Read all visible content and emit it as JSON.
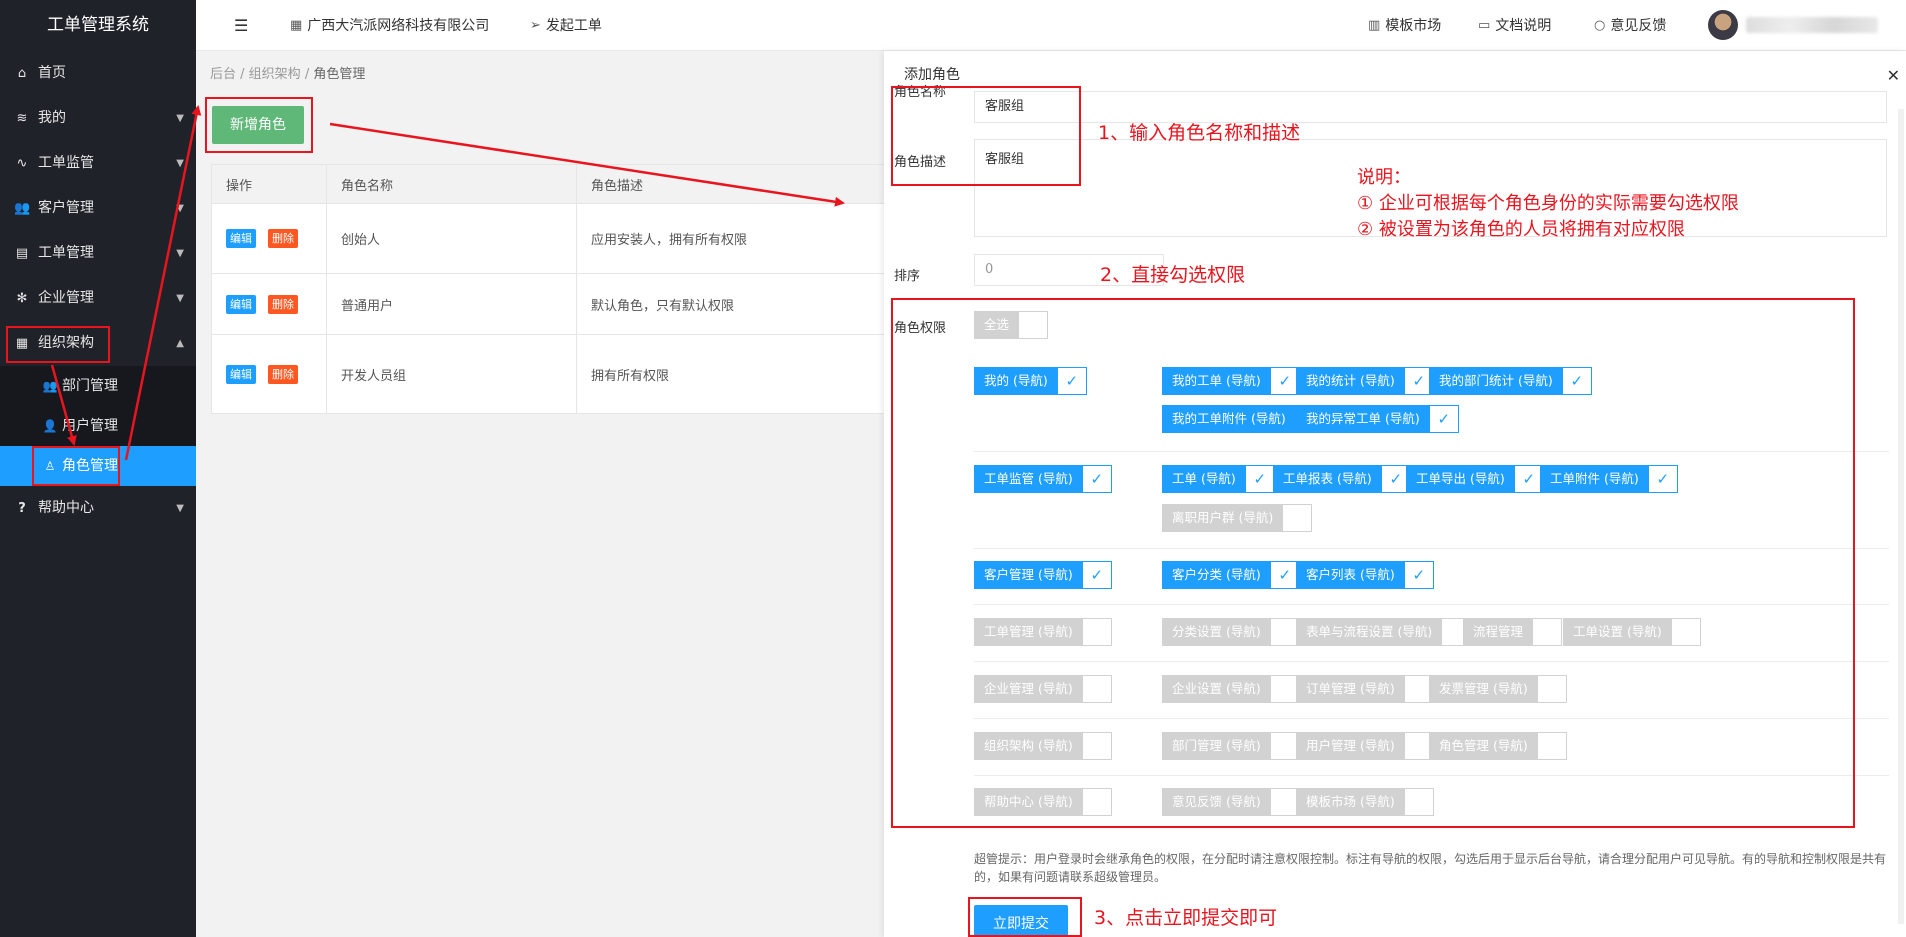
{
  "app": {
    "title": "工单管理系统"
  },
  "sidebar": {
    "items": [
      {
        "label": "首页",
        "icon": "home-icon"
      },
      {
        "label": "我的",
        "icon": "layers-icon"
      },
      {
        "label": "工单监管",
        "icon": "pulse-icon"
      },
      {
        "label": "客户管理",
        "icon": "users-icon"
      },
      {
        "label": "工单管理",
        "icon": "document-icon"
      },
      {
        "label": "企业管理",
        "icon": "gear-icon"
      },
      {
        "label": "组织架构",
        "icon": "org-icon"
      },
      {
        "label": "帮助中心",
        "icon": "question-icon"
      }
    ],
    "sub_items": [
      {
        "label": "部门管理",
        "icon": "users-icon"
      },
      {
        "label": "用户管理",
        "icon": "user-icon"
      },
      {
        "label": "角色管理",
        "icon": "user-outline-icon",
        "active": true
      }
    ]
  },
  "header": {
    "company": "广西大汽派网络科技有限公司",
    "create_ticket": "发起工单",
    "template_market": "模板市场",
    "docs": "文档说明",
    "feedback": "意见反馈"
  },
  "main": {
    "breadcrumb": [
      "后台",
      "组织架构",
      "角色管理"
    ],
    "add_button": "新增角色",
    "table": {
      "headers": [
        "操作",
        "角色名称",
        "角色描述"
      ],
      "edit_label": "编辑",
      "delete_label": "删除",
      "rows": [
        {
          "name": "创始人",
          "desc": "应用安装人，拥有所有权限"
        },
        {
          "name": "普通用户",
          "desc": "默认角色，只有默认权限"
        },
        {
          "name": "开发人员组",
          "desc": "拥有所有权限"
        }
      ]
    }
  },
  "drawer": {
    "title": "添加角色",
    "close": "✕",
    "role_name_label": "角色名称",
    "role_name_value": "客服组",
    "role_desc_label": "角色描述",
    "role_desc_value": "客服组",
    "sort_label": "排序",
    "sort_value": "0",
    "perm_label": "角色权限",
    "select_all": "全选",
    "permissions": [
      {
        "label": "我的 (导航)",
        "checked": true
      },
      {
        "label": "我的工单 (导航)",
        "checked": true
      },
      {
        "label": "我的统计 (导航)",
        "checked": true
      },
      {
        "label": "我的部门统计 (导航)",
        "checked": true
      },
      {
        "label": "我的工单附件 (导航)",
        "checked": true
      },
      {
        "label": "我的异常工单 (导航)",
        "checked": true
      },
      {
        "label": "工单监管 (导航)",
        "checked": true
      },
      {
        "label": "工单 (导航)",
        "checked": true
      },
      {
        "label": "工单报表 (导航)",
        "checked": true
      },
      {
        "label": "工单导出 (导航)",
        "checked": true
      },
      {
        "label": "工单附件 (导航)",
        "checked": true
      },
      {
        "label": "离职用户群 (导航)",
        "checked": false
      },
      {
        "label": "客户管理 (导航)",
        "checked": true
      },
      {
        "label": "客户分类 (导航)",
        "checked": true
      },
      {
        "label": "客户列表 (导航)",
        "checked": true
      },
      {
        "label": "工单管理 (导航)",
        "checked": false
      },
      {
        "label": "分类设置 (导航)",
        "checked": false
      },
      {
        "label": "表单与流程设置 (导航)",
        "checked": false
      },
      {
        "label": "流程管理",
        "checked": false
      },
      {
        "label": "工单设置 (导航)",
        "checked": false
      },
      {
        "label": "企业管理 (导航)",
        "checked": false
      },
      {
        "label": "企业设置 (导航)",
        "checked": false
      },
      {
        "label": "订单管理 (导航)",
        "checked": false
      },
      {
        "label": "发票管理 (导航)",
        "checked": false
      },
      {
        "label": "组织架构 (导航)",
        "checked": false
      },
      {
        "label": "部门管理 (导航)",
        "checked": false
      },
      {
        "label": "用户管理 (导航)",
        "checked": false
      },
      {
        "label": "角色管理 (导航)",
        "checked": false
      },
      {
        "label": "帮助中心 (导航)",
        "checked": false
      },
      {
        "label": "意见反馈 (导航)",
        "checked": false
      },
      {
        "label": "模板市场 (导航)",
        "checked": false
      }
    ],
    "tip": "超管提示：用户登录时会继承角色的权限，在分配时请注意权限控制。标注有导航的权限，勾选后用于显示后台导航，请合理分配用户可见导航。有的导航和控制权限是共有的，如果有问题请联系超级管理员。",
    "submit": "立即提交"
  },
  "annotations": {
    "step1": "1、输入角色名称和描述",
    "step2": "2、直接勾选权限",
    "step3": "3、点击立即提交即可",
    "note_title": "说明：",
    "note_1": "① 企业可根据每个角色身份的实际需要勾选权限",
    "note_2": "② 被设置为该角色的人员将拥有对应权限",
    "color": "#e8151f"
  },
  "colors": {
    "sidebar_bg": "#20222a",
    "active_blue": "#1e9fff",
    "green": "#5fb878",
    "danger": "#ff5722"
  }
}
